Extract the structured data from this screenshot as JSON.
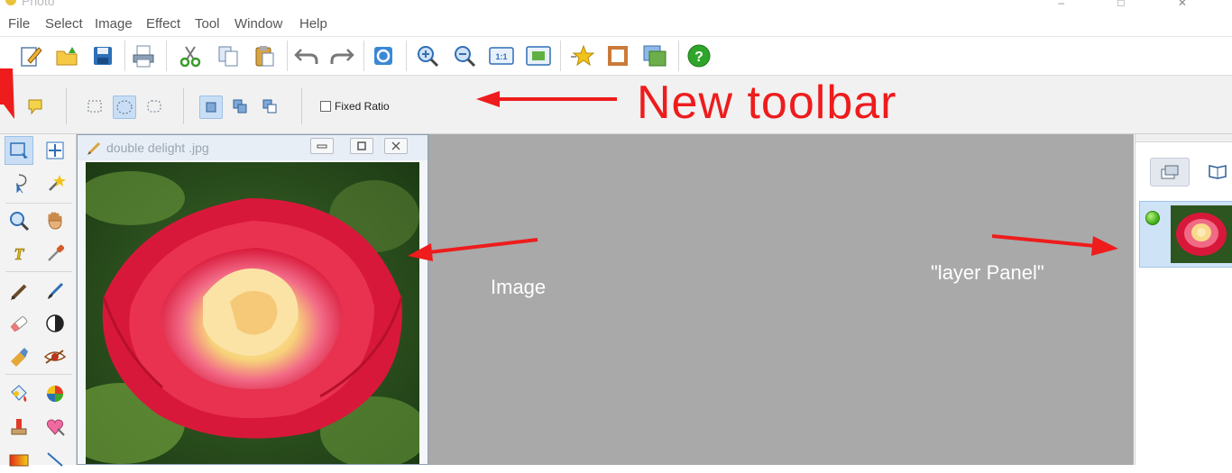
{
  "app": {
    "title": "Photo"
  },
  "menu": [
    "File",
    "Select",
    "Image",
    "Effect",
    "Tool",
    "Window",
    "Help"
  ],
  "main_toolbar": {
    "icons": [
      "new-icon",
      "open-icon",
      "save-icon",
      "print-icon",
      "cut-icon",
      "copy-icon",
      "paste-icon",
      "undo-icon",
      "redo-icon",
      "refresh-icon",
      "zoom-in-icon",
      "zoom-out-icon",
      "actual-size-icon",
      "fit-window-icon",
      "favorite-icon",
      "frame-icon",
      "layers-icon",
      "help-icon"
    ]
  },
  "selection_toolbar": {
    "fixed_ratio_label": "Fixed Ratio",
    "fixed_ratio_checked": false,
    "shape_selected": "ellipse",
    "mode_selected": "replace"
  },
  "document": {
    "title": "double delight .jpg"
  },
  "annotations": {
    "toolbar_label": "New toolbar",
    "image_label": "Image",
    "layer_panel_label": "\"layer Panel\"",
    "color": "#ee1c1c"
  },
  "colors": {
    "workspace": "#a9a9a9",
    "accent": "#c9def5"
  }
}
